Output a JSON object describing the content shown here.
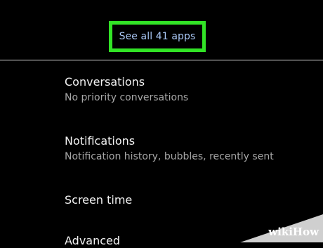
{
  "header": {
    "see_all_label": "See all 41 apps",
    "highlight_color": "#32e326"
  },
  "settings_items": [
    {
      "title": "Conversations",
      "subtitle": "No priority conversations"
    },
    {
      "title": "Notifications",
      "subtitle": "Notification history, bubbles, recently sent"
    },
    {
      "title": "Screen time"
    },
    {
      "title": "Advanced"
    }
  ],
  "watermark": {
    "brand": "wikiHow"
  }
}
